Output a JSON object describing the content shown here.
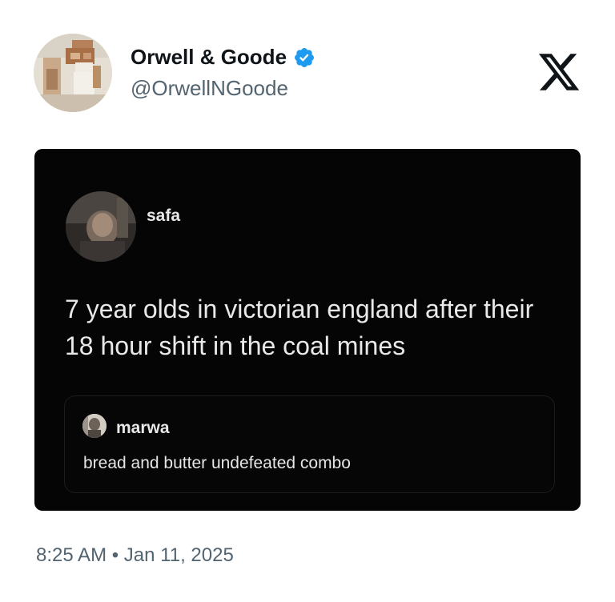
{
  "author": {
    "display_name": "Orwell & Goode",
    "handle": "@OrwellNGoode",
    "verified": true,
    "verified_color": "#1d9bf0"
  },
  "logo": "x-logo-icon",
  "embedded_post": {
    "author": "safa",
    "text": "7 year olds in victorian england after their 18 hour shift in the coal mines",
    "reply": {
      "author": "marwa",
      "text": "bread and butter undefeated combo"
    }
  },
  "timestamp": "8:25 AM • Jan 11, 2025"
}
